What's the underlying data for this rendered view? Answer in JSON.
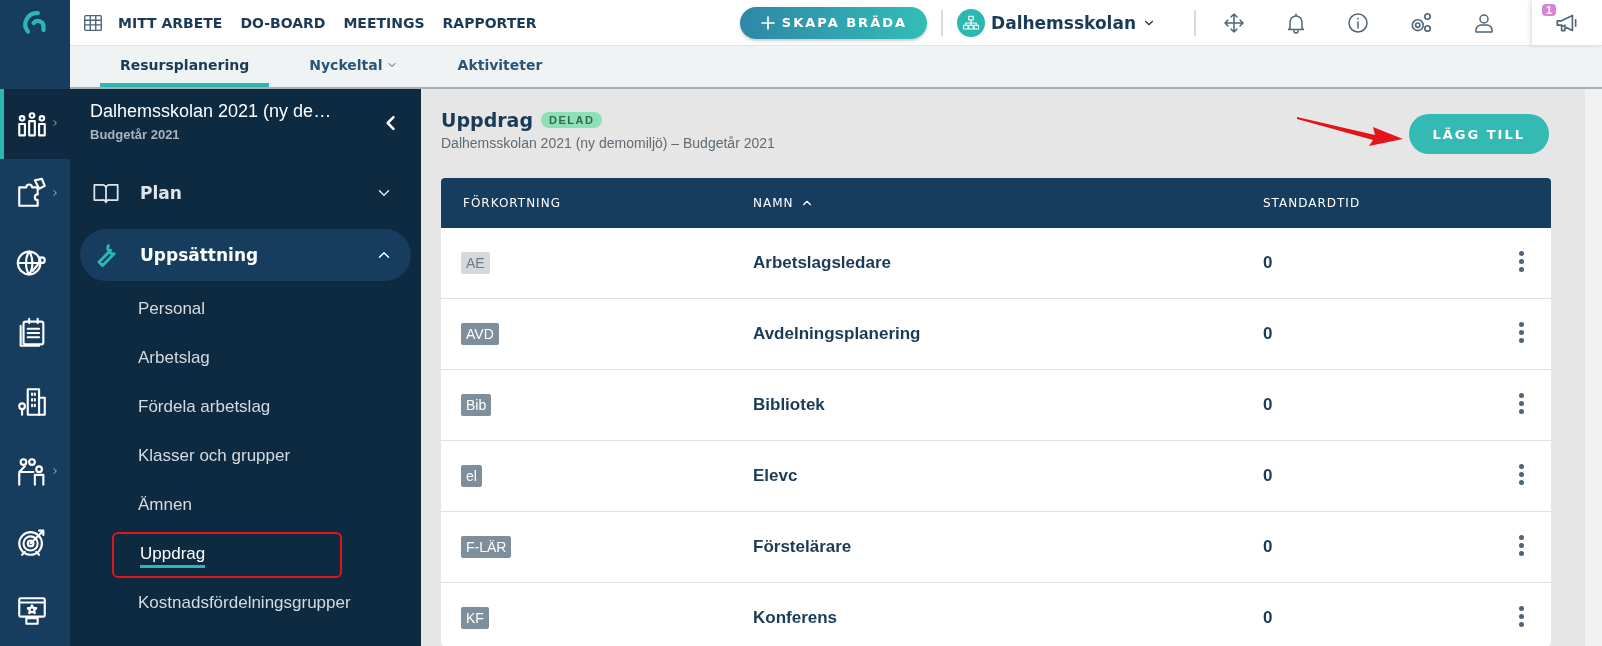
{
  "topbar": {
    "nav": [
      "MITT ARBETE",
      "DO-BOARD",
      "MEETINGS",
      "RAPPORTER"
    ],
    "create_button": "SKAPA BRÄDA",
    "org": "Dalhemsskolan",
    "notification_badge": "1"
  },
  "subnav": [
    {
      "label": "Resursplanering",
      "selected": true,
      "dropdown": false
    },
    {
      "label": "Nyckeltal",
      "selected": false,
      "dropdown": true
    },
    {
      "label": "Aktiviteter",
      "selected": false,
      "dropdown": false
    }
  ],
  "rail": [
    {
      "selected": true,
      "submenu": true
    },
    {
      "selected": false,
      "submenu": true
    },
    {
      "selected": false,
      "submenu": false
    },
    {
      "selected": false,
      "submenu": false
    },
    {
      "selected": false,
      "submenu": false
    },
    {
      "selected": false,
      "submenu": true
    },
    {
      "selected": false,
      "submenu": false
    },
    {
      "selected": false,
      "submenu": false
    }
  ],
  "sidebar": {
    "title": "Dalhemsskolan 2021 (ny de…",
    "subtitle": "Budgetår 2021",
    "groups": [
      {
        "label": "Plan",
        "expanded": false
      },
      {
        "label": "Uppsättning",
        "expanded": true,
        "children": [
          {
            "label": "Personal",
            "selected": false,
            "annotated": false
          },
          {
            "label": "Arbetslag",
            "selected": false,
            "annotated": false
          },
          {
            "label": "Fördela arbetslag",
            "selected": false,
            "annotated": false
          },
          {
            "label": "Klasser och grupper",
            "selected": false,
            "annotated": false
          },
          {
            "label": "Ämnen",
            "selected": false,
            "annotated": false
          },
          {
            "label": "Uppdrag",
            "selected": true,
            "annotated": true
          },
          {
            "label": "Kostnadsfördelningsgrupper",
            "selected": false,
            "annotated": false
          }
        ]
      }
    ]
  },
  "page": {
    "title": "Uppdrag",
    "badge": "DELAD",
    "subtitle": "Dalhemsskolan 2021 (ny demomiljö) – Budgetår 2021",
    "add_button": "LÄGG TILL",
    "add_button_annotated": true
  },
  "table": {
    "columns": [
      {
        "label": "FÖRKORTNING",
        "sorted": false
      },
      {
        "label": "NAMN",
        "sorted": true
      },
      {
        "label": "STANDARDTID",
        "sorted": false
      }
    ],
    "rows": [
      {
        "abbr": "AE",
        "disabled": true,
        "name": "Arbetslagsledare",
        "time": "0"
      },
      {
        "abbr": "AVD",
        "disabled": false,
        "name": "Avdelningsplanering",
        "time": "0"
      },
      {
        "abbr": "Bib",
        "disabled": false,
        "name": "Bibliotek",
        "time": "0"
      },
      {
        "abbr": "el",
        "disabled": false,
        "name": "Elevc",
        "time": "0"
      },
      {
        "abbr": "F-LÄR",
        "disabled": false,
        "name": "Förstelärare",
        "time": "0"
      },
      {
        "abbr": "KF",
        "disabled": false,
        "name": "Konferens",
        "time": "0"
      }
    ]
  }
}
